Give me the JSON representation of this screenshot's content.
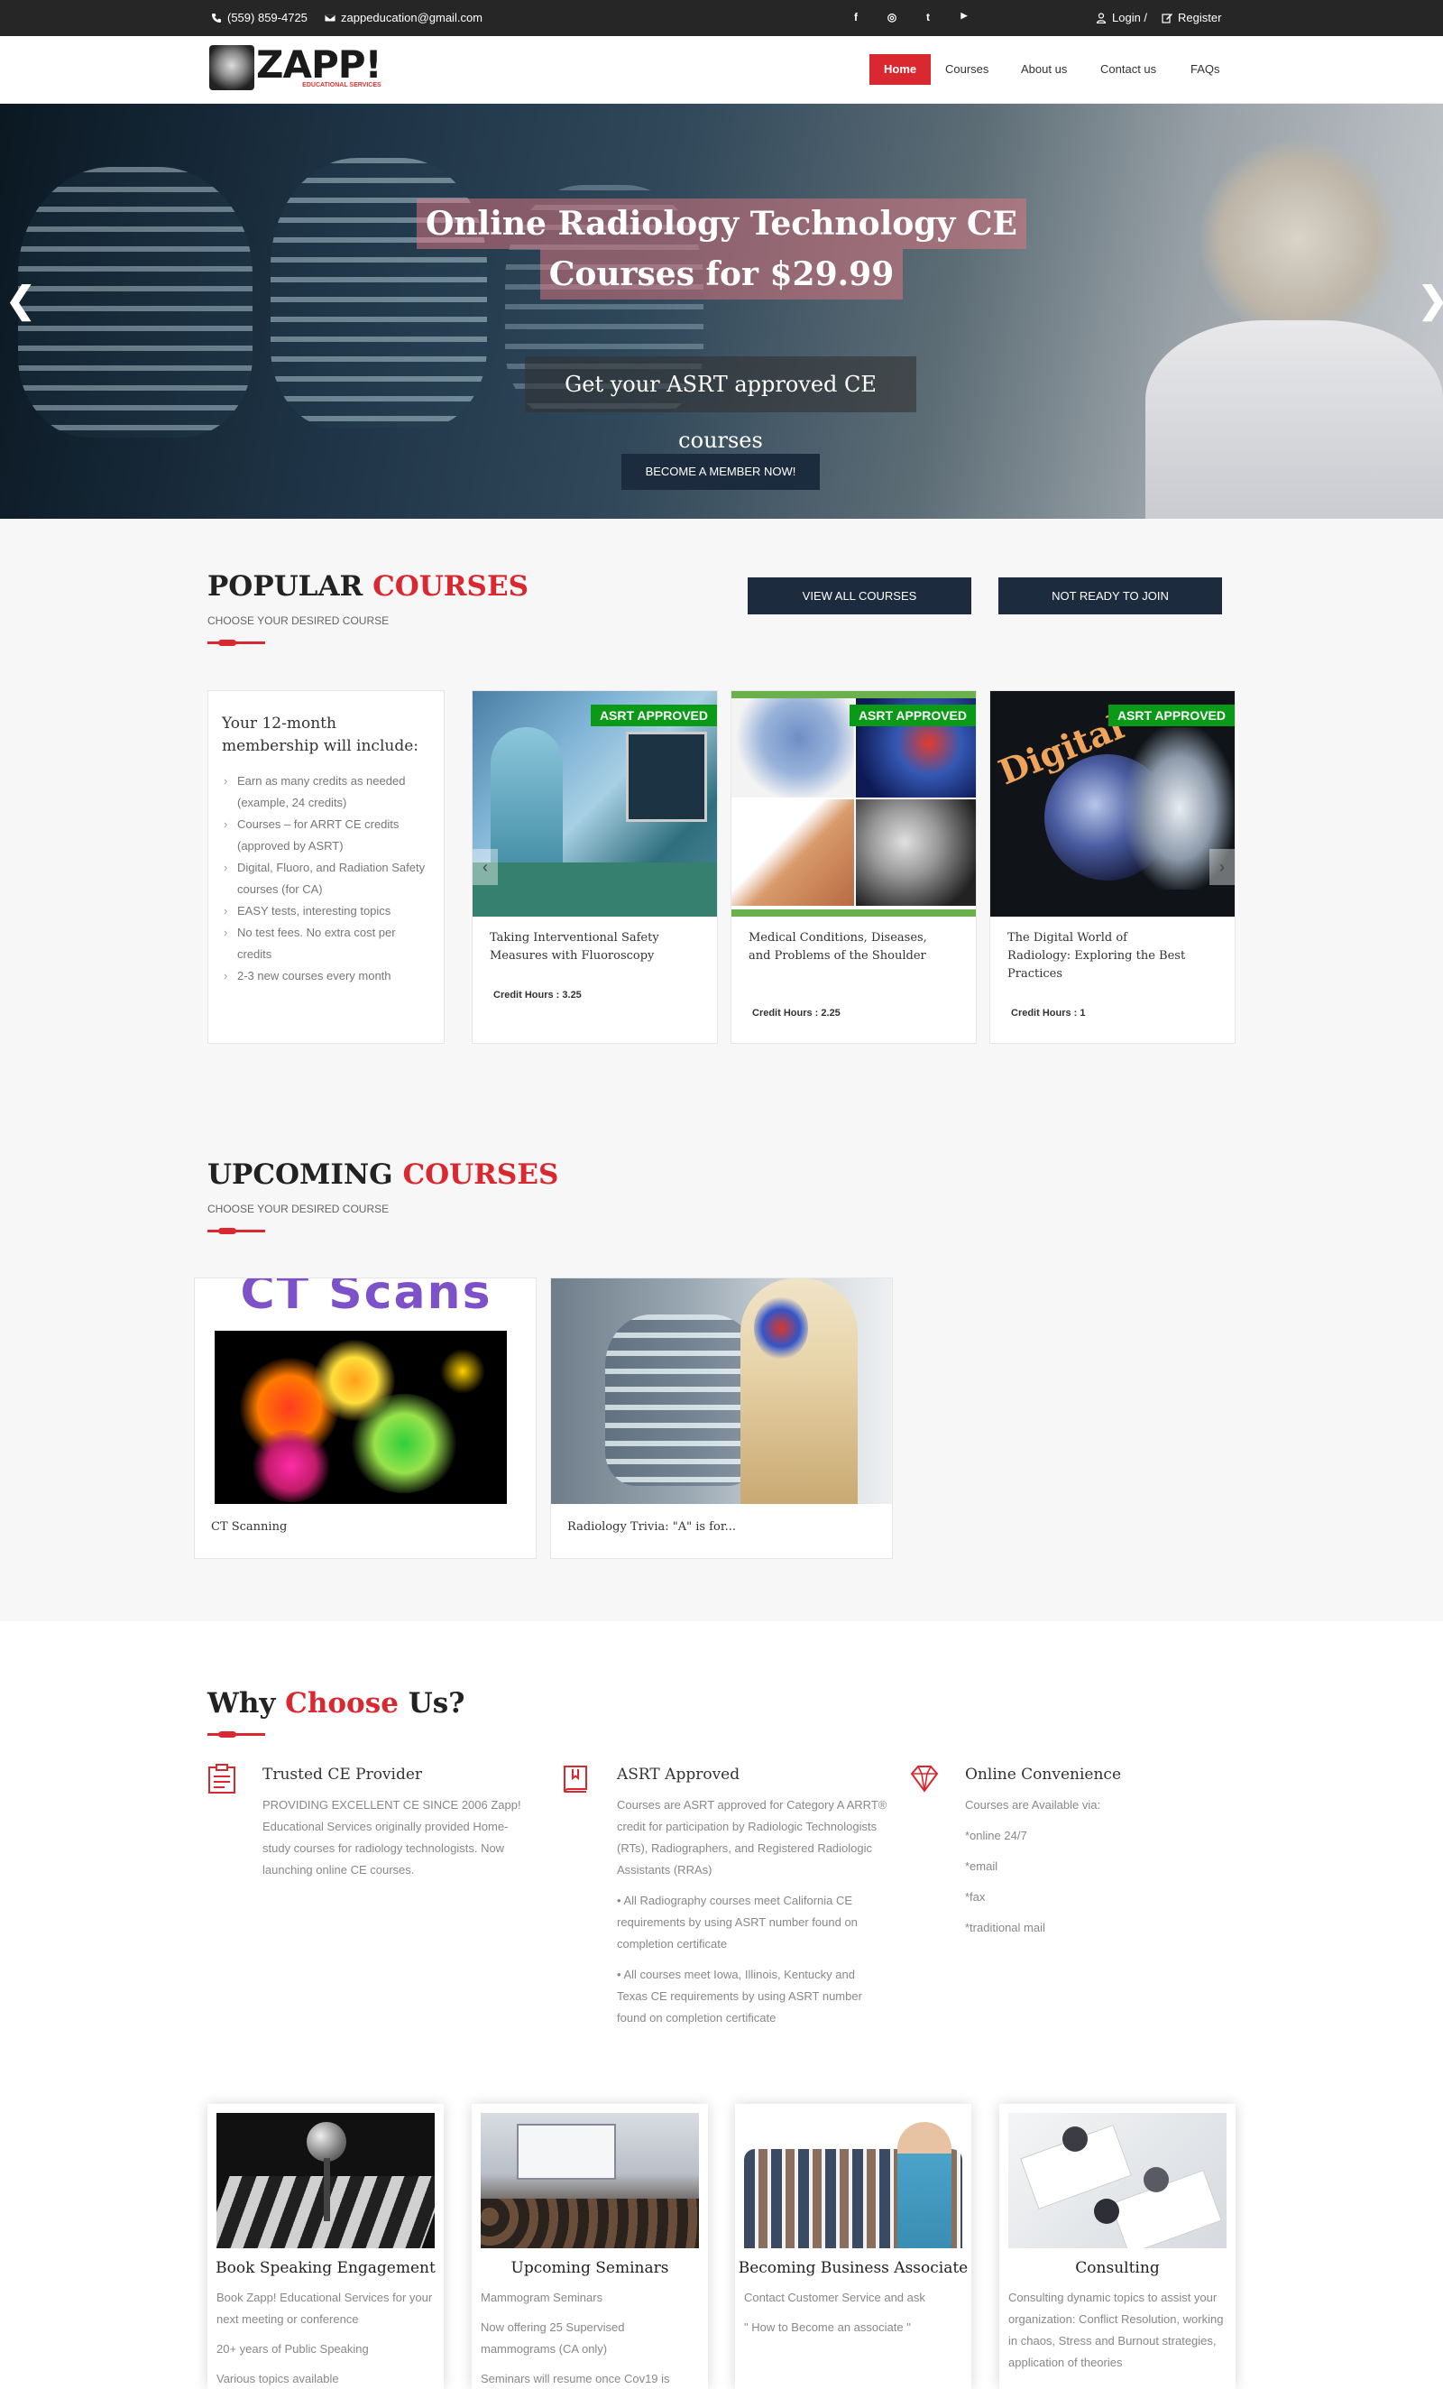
{
  "topbar": {
    "phone": "(559) 859-4725",
    "email": "zappeducation@gmail.com",
    "social": [
      "f",
      "◎",
      "t",
      "▶"
    ],
    "login": "Login /",
    "register": "Register"
  },
  "nav": {
    "logo_text": "ZAPP!",
    "logo_sub": "EDUCATIONAL SERVICES",
    "items": [
      "Home",
      "Courses",
      "About us",
      "Contact us",
      "FAQs"
    ]
  },
  "hero": {
    "title_line1": "Online Radiology Technology CE",
    "title_line2": "Courses for $29.99",
    "subtitle": "Get your ASRT approved CE courses",
    "button": "BECOME A MEMBER NOW!",
    "prev": "❮",
    "next": "❯"
  },
  "popular": {
    "title_a": "POPULAR ",
    "title_b": "COURSES",
    "subtitle": "CHOOSE YOUR DESIRED COURSE",
    "btn_all": "VIEW ALL COURSES",
    "btn_not_ready": "NOT READY TO JOIN",
    "membership": {
      "title": "Your 12-month membership will include:",
      "items": [
        "Earn as many credits as needed (example, 24 credits)",
        "Courses – for ARRT CE credits (approved by ASRT)",
        "Digital, Fluoro, and Radiation Safety courses (for CA)",
        "EASY tests, interesting topics",
        "No test fees. No extra cost per credits",
        "2-3 new courses every month"
      ]
    },
    "courses": [
      {
        "badge": "ASRT APPROVED",
        "name": "Taking Interventional Safety Measures with Fluoroscopy",
        "credit": "Credit Hours : 3.25"
      },
      {
        "badge": "ASRT APPROVED",
        "name": "Medical Conditions, Diseases, and Problems of the Shoulder",
        "credit": "Credit Hours : 2.25"
      },
      {
        "badge": "ASRT APPROVED",
        "name": "The Digital World of Radiology: Exploring the Best Practices",
        "credit": "Credit Hours : 1",
        "image_text": "Digital"
      }
    ]
  },
  "upcoming": {
    "title_a": "UPCOMING ",
    "title_b": "COURSES",
    "subtitle": "CHOOSE YOUR DESIRED COURSE",
    "courses": [
      {
        "name": "CT Scanning",
        "image_text": "CT Scans"
      },
      {
        "name": "Radiology Trivia: \"A\" is for..."
      }
    ]
  },
  "why": {
    "title_a": "Why ",
    "title_b": "Choose",
    "title_c": " Us?",
    "features": [
      {
        "icon": "clipboard-icon",
        "title": "Trusted CE Provider",
        "paragraphs": [
          "PROVIDING EXCELLENT CE SINCE 2006 Zapp! Educational Services originally provided Home-study courses for radiology technologists. Now launching online CE courses."
        ]
      },
      {
        "icon": "book-icon",
        "title": "ASRT Approved",
        "paragraphs": [
          "Courses are ASRT approved for Category A ARRT® credit for participation by Radiologic Technologists (RTs), Radiographers, and Registered Radiologic Assistants (RRAs)",
          "• All Radiography courses meet California CE requirements by using ASRT number found on completion certificate",
          "• All courses meet Iowa, Illinois, Kentucky and Texas CE requirements by using ASRT number found on completion certificate"
        ]
      },
      {
        "icon": "diamond-icon",
        "title": "Online Convenience",
        "paragraphs": [
          "Courses are Available via:",
          "*online 24/7",
          "*email",
          "*fax",
          "*traditional mail"
        ]
      }
    ]
  },
  "services": [
    {
      "title": "Book Speaking Engagement",
      "paragraphs": [
        "Book Zapp! Educational Services for your next meeting or conference",
        "20+ years of Public Speaking",
        "Various topics available"
      ]
    },
    {
      "title": "Upcoming Seminars",
      "paragraphs": [
        "Mammogram Seminars",
        "Now offering 25 Supervised mammograms (CA only)",
        "Seminars will resume once Cov19 is"
      ]
    },
    {
      "title": "Becoming Business Associate",
      "paragraphs": [
        "Contact Customer Service and ask",
        "\" How to Become an associate \""
      ]
    },
    {
      "title": "Consulting",
      "paragraphs": [
        "Consulting dynamic topics to assist your organization: Conflict Resolution, working in chaos, Stress and Burnout strategies, application of theories"
      ]
    }
  ],
  "colors": {
    "accent": "#d9282f",
    "navy": "#1d2b3f",
    "badge_green": "#0a9a17",
    "topbar": "#262626"
  }
}
